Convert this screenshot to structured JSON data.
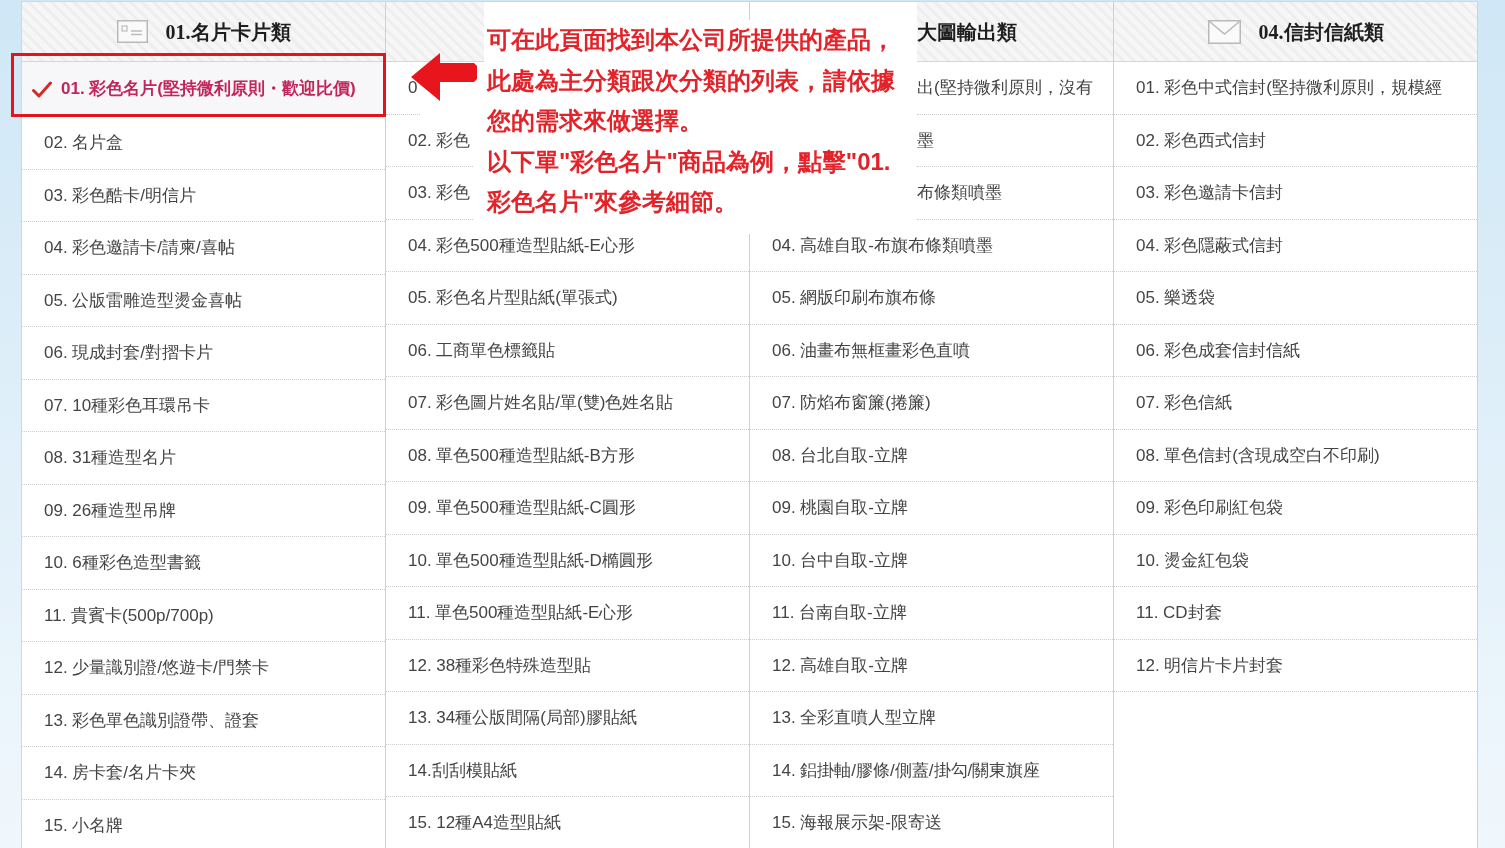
{
  "columns": [
    {
      "heading": {
        "text": "01.名片卡片類",
        "kind": "card"
      },
      "items": [
        {
          "text": "01. 彩色名片(堅持微利原則・歡迎比價)",
          "selected": true
        },
        {
          "text": "02. 名片盒",
          "selected": false
        },
        {
          "text": "03. 彩色酷卡/明信片",
          "selected": false
        },
        {
          "text": "04. 彩色邀請卡/請柬/喜帖",
          "selected": false
        },
        {
          "text": "05. 公版雷雕造型燙金喜帖",
          "selected": false
        },
        {
          "text": "06. 現成封套/對摺卡片",
          "selected": false
        },
        {
          "text": "07. 10種彩色耳環吊卡",
          "selected": false
        },
        {
          "text": "08. 31種造型名片",
          "selected": false
        },
        {
          "text": "09. 26種造型吊牌",
          "selected": false
        },
        {
          "text": "10. 6種彩色造型書籤",
          "selected": false
        },
        {
          "text": "11. 貴賓卡(500p/700p)",
          "selected": false
        },
        {
          "text": "12. 少量識別證/悠遊卡/門禁卡",
          "selected": false
        },
        {
          "text": "13. 彩色單色識別證帶、證套",
          "selected": false
        },
        {
          "text": "14. 房卡套/名片卡夾",
          "selected": false
        },
        {
          "text": "15. 小名牌",
          "selected": false
        }
      ]
    },
    {
      "items": [
        {
          "text": "0",
          "selected": false,
          "kind": "cut"
        },
        {
          "text": "02. 彩色",
          "selected": false,
          "kind": "cut"
        },
        {
          "text": "03. 彩色",
          "selected": false,
          "kind": "cut"
        },
        {
          "text": "04. 彩色500種造型貼紙-E心形",
          "selected": false,
          "kind": "item"
        },
        {
          "text": "05. 彩色名片型貼紙(單張式)",
          "selected": false,
          "kind": "item"
        },
        {
          "text": "06. 工商單色標籤貼",
          "selected": false,
          "kind": "item"
        },
        {
          "text": "07. 彩色圖片姓名貼/單(雙)色姓名貼",
          "selected": false,
          "kind": "item"
        },
        {
          "text": "08. 單色500種造型貼紙-B方形",
          "selected": false,
          "kind": "item"
        },
        {
          "text": "09. 單色500種造型貼紙-C圓形",
          "selected": false,
          "kind": "item"
        },
        {
          "text": "10. 單色500種造型貼紙-D橢圓形",
          "selected": false,
          "kind": "item"
        },
        {
          "text": "11. 單色500種造型貼紙-E心形",
          "selected": false,
          "kind": "item"
        },
        {
          "text": "12. 38種彩色特殊造型貼",
          "selected": false,
          "kind": "item"
        },
        {
          "text": "13. 34種公版間隔(局部)膠貼紙",
          "selected": false,
          "kind": "item"
        },
        {
          "text": "14.刮刮模貼紙",
          "selected": false,
          "kind": "item"
        },
        {
          "text": "15. 12種A4造型貼紙",
          "selected": false,
          "kind": "item"
        }
      ]
    },
    {
      "heading": {
        "text": "大圖輸出類",
        "kind": "covered"
      },
      "items": [
        {
          "text": "出(堅持微利原則，沒有",
          "selected": false,
          "kind": "covered"
        },
        {
          "text": "墨",
          "selected": false,
          "kind": "covered"
        },
        {
          "text": "布條類噴墨",
          "selected": false,
          "kind": "covered"
        },
        {
          "text": "04. 高雄自取-布旗布條類噴墨",
          "selected": false,
          "kind": "item"
        },
        {
          "text": "05. 網版印刷布旗布條",
          "selected": false,
          "kind": "item"
        },
        {
          "text": "06. 油畫布無框畫彩色直噴",
          "selected": false,
          "kind": "item"
        },
        {
          "text": "07. 防焰布窗簾(捲簾)",
          "selected": false,
          "kind": "item"
        },
        {
          "text": "08. 台北自取-立牌",
          "selected": false,
          "kind": "item"
        },
        {
          "text": "09. 桃園自取-立牌",
          "selected": false,
          "kind": "item"
        },
        {
          "text": "10. 台中自取-立牌",
          "selected": false,
          "kind": "item"
        },
        {
          "text": "11. 台南自取-立牌",
          "selected": false,
          "kind": "item"
        },
        {
          "text": "12. 高雄自取-立牌",
          "selected": false,
          "kind": "item"
        },
        {
          "text": "13. 全彩直噴人型立牌",
          "selected": false,
          "kind": "item"
        },
        {
          "text": "14. 鋁掛軸/膠條/側蓋/掛勾/關東旗座",
          "selected": false,
          "kind": "item"
        },
        {
          "text": "15. 海報展示架-限寄送",
          "selected": false,
          "kind": "item"
        }
      ]
    },
    {
      "heading": {
        "text": "04.信封信紙類",
        "kind": "envelope"
      },
      "items": [
        {
          "text": "01. 彩色中式信封(堅持微利原則，規模經",
          "selected": false
        },
        {
          "text": "02. 彩色西式信封",
          "selected": false
        },
        {
          "text": "03. 彩色邀請卡信封",
          "selected": false
        },
        {
          "text": "04. 彩色隱蔽式信封",
          "selected": false
        },
        {
          "text": "05. 樂透袋",
          "selected": false
        },
        {
          "text": "06. 彩色成套信封信紙",
          "selected": false
        },
        {
          "text": "07. 彩色信紙",
          "selected": false
        },
        {
          "text": "08. 單色信封(含現成空白不印刷)",
          "selected": false
        },
        {
          "text": "09. 彩色印刷紅包袋",
          "selected": false
        },
        {
          "text": "10. 燙金紅包袋",
          "selected": false
        },
        {
          "text": "11. CD封套",
          "selected": false
        },
        {
          "text": "12. 明信片卡片封套",
          "selected": false
        }
      ]
    }
  ],
  "callout": {
    "paragraphs": [
      "可在此頁面找到本公司所提供的產品，此處為主分類跟次分類的列表，請依據您的需求來做選擇。",
      "以下單\"彩色名片\"商品為例，點擊\"01. 彩色名片\"來參考細節。"
    ]
  }
}
